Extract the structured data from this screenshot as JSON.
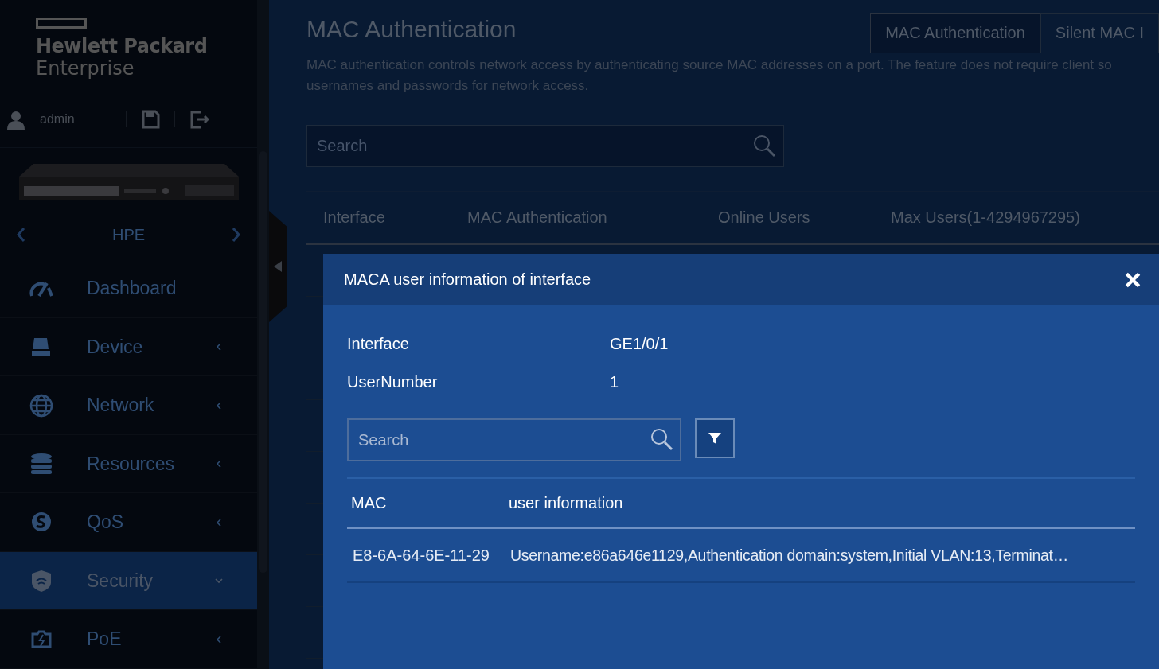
{
  "logo": {
    "line1": "Hewlett Packard",
    "line2": "Enterprise"
  },
  "user": {
    "name": "admin"
  },
  "device": {
    "name": "HPE"
  },
  "nav": [
    {
      "label": "Dashboard",
      "expandable": false,
      "expanded": false,
      "selected": false
    },
    {
      "label": "Device",
      "expandable": true,
      "expanded": false,
      "selected": false
    },
    {
      "label": "Network",
      "expandable": true,
      "expanded": false,
      "selected": false
    },
    {
      "label": "Resources",
      "expandable": true,
      "expanded": false,
      "selected": false
    },
    {
      "label": "QoS",
      "expandable": true,
      "expanded": false,
      "selected": false
    },
    {
      "label": "Security",
      "expandable": true,
      "expanded": true,
      "selected": true
    },
    {
      "label": "PoE",
      "expandable": true,
      "expanded": false,
      "selected": false
    }
  ],
  "page": {
    "title": "MAC Authentication",
    "description": "MAC authentication controls network access by authenticating source MAC addresses on a port. The feature does not require client so usernames and passwords for network access.",
    "tabs": [
      {
        "label": "MAC Authentication",
        "selected": true
      },
      {
        "label": "Silent MAC I",
        "selected": false
      }
    ],
    "search": {
      "placeholder": "Search"
    },
    "table": {
      "columns": [
        "Interface",
        "MAC Authentication",
        "Online Users",
        "Max Users(1-4294967295)"
      ]
    }
  },
  "modal": {
    "title": "MACA user information of interface",
    "fields": [
      {
        "label": "Interface",
        "value": "GE1/0/1"
      },
      {
        "label": "UserNumber",
        "value": "1"
      }
    ],
    "search": {
      "placeholder": "Search"
    },
    "table": {
      "columns": [
        "MAC",
        "user information"
      ],
      "rows": [
        {
          "mac": "E8-6A-64-6E-11-29",
          "info": "Username:e86a646e1129,Authentication domain:system,Initial VLAN:13,Terminat…"
        }
      ]
    }
  }
}
